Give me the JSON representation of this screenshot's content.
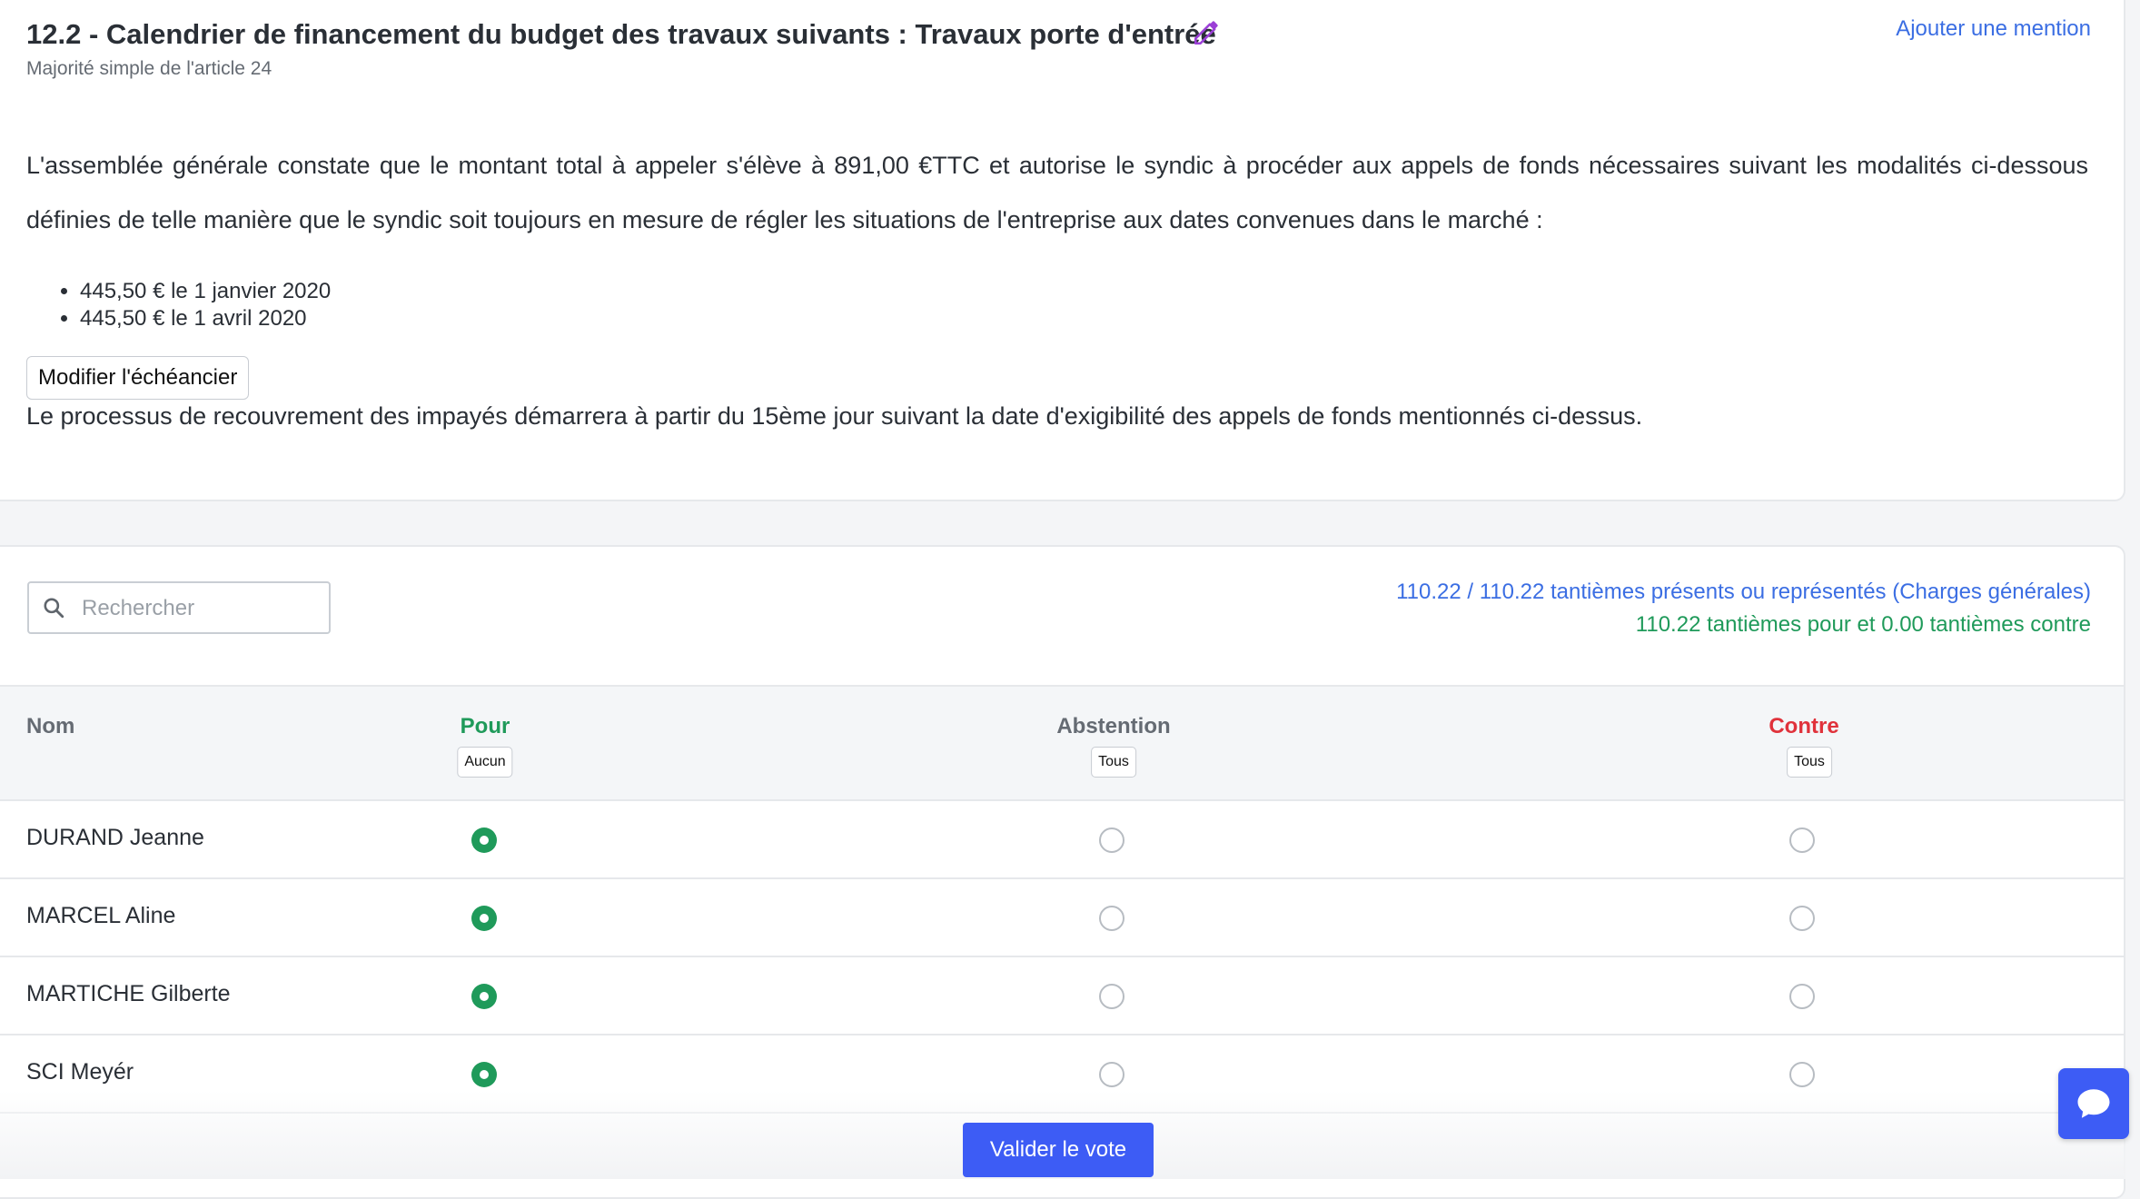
{
  "resolution": {
    "title": "12.2 - Calendrier de financement du budget des travaux suivants : Travaux porte d'entrée",
    "subtitle": "Majorité simple de l'article 24",
    "add_mention_label": "Ajouter une mention",
    "paragraph_1": "L'assemblée générale constate que le montant total à appeler s'élève à 891,00 €TTC et autorise le syndic à procéder aux appels de fonds nécessaires suivant les modalités ci-dessous définies de telle manière que le syndic soit toujours en mesure de régler les situations de l'entreprise aux dates convenues dans le marché :",
    "schedule": [
      "445,50 € le 1 janvier 2020",
      "445,50 € le 1 avril 2020"
    ],
    "modify_button_label": "Modifier l'échéancier",
    "paragraph_2": "Le processus de recouvrement des impayés démarrera à partir du 15ème jour suivant la date d'exigibilité des appels de fonds mentionnés ci-dessus.",
    "edit_icon": "pencil-icon"
  },
  "vote": {
    "search_placeholder": "Rechercher",
    "search_value": "",
    "present_summary": "110.22 / 110.22 tantièmes présents ou représentés (Charges générales)",
    "vote_summary": "110.22 tantièmes pour et 0.00 tantièmes contre",
    "columns": {
      "name": "Nom",
      "for": "Pour",
      "abstention": "Abstention",
      "against": "Contre"
    },
    "bulk_buttons": {
      "for": "Aucun",
      "abstention": "Tous",
      "against": "Tous"
    },
    "rows": [
      {
        "name": "DURAND Jeanne",
        "choice": "for"
      },
      {
        "name": "MARCEL Aline",
        "choice": "for"
      },
      {
        "name": "MARTICHE Gilberte",
        "choice": "for"
      },
      {
        "name": "SCI Meyér",
        "choice": "for"
      }
    ],
    "validate_label": "Valider le vote"
  },
  "colors": {
    "accent_blue": "#3b6ee3",
    "primary_button": "#3d5cf5",
    "for_green": "#1f9a5a",
    "against_red": "#e0323b"
  },
  "icons": {
    "search": "search-icon",
    "chat": "chat-bubble-icon"
  }
}
